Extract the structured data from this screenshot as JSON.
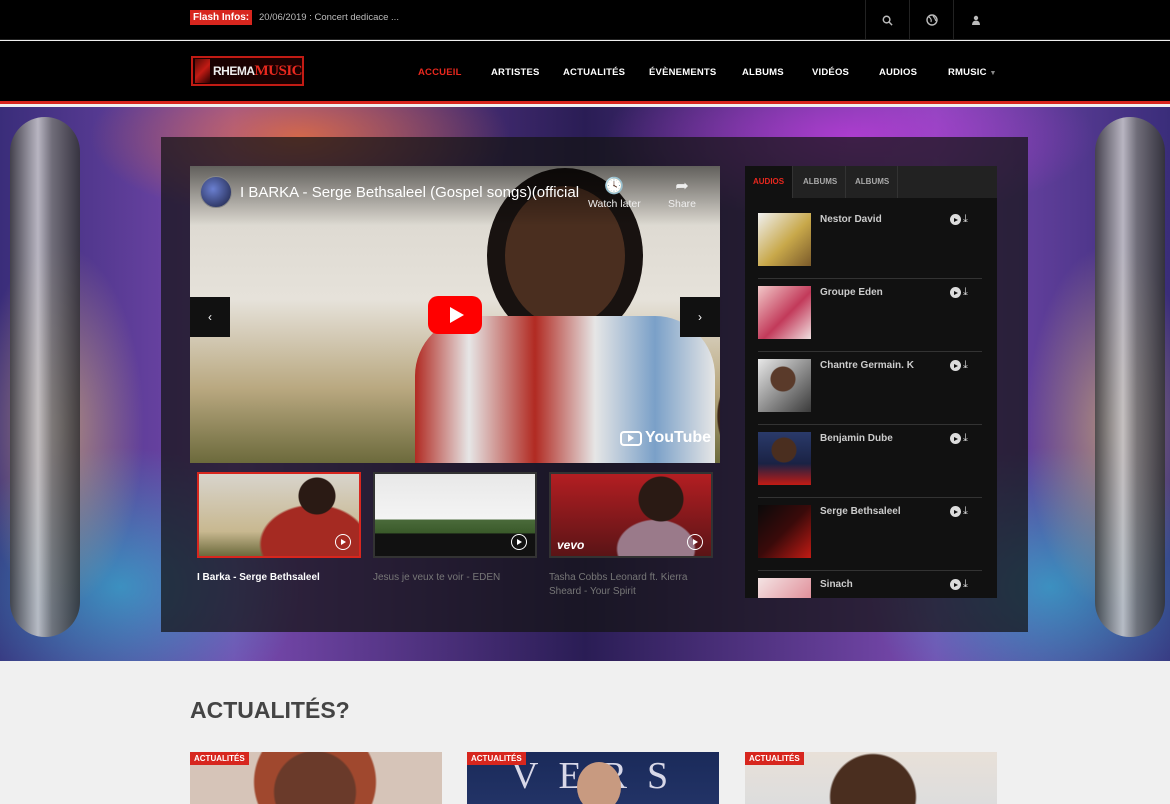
{
  "topbar": {
    "flash_label": "Flash Infos:",
    "flash_text": "20/06/2019 : Concert dedicace ..."
  },
  "logo": {
    "part1": "RHEMA",
    "part2": "MUSIC"
  },
  "nav": {
    "items": [
      "ACCUEIL",
      "ARTISTES",
      "ACTUALITÉS",
      "ÉVÈNEMENTS",
      "ALBUMS",
      "VIDÉOS",
      "AUDIOS",
      "RMUSIC"
    ],
    "active": "ACCUEIL"
  },
  "video": {
    "title": "I BARKA - Serge Bethsaleel (Gospel songs)(official ...",
    "watch_later": "Watch later",
    "share": "Share",
    "brand": "YouTube"
  },
  "thumbs": [
    {
      "caption": "I Barka - Serge Bethsaleel"
    },
    {
      "caption": "Jesus je veux te voir - EDEN"
    },
    {
      "caption": "Tasha Cobbs Leonard ft. Kierra Sheard - Your Spirit",
      "overlay": "vevo"
    }
  ],
  "audio_panel": {
    "tabs": [
      "AUDIOS",
      "ALBUMS",
      "ALBUMS"
    ],
    "active_tab": "AUDIOS",
    "tracks": [
      "Nestor David",
      "Groupe Eden",
      "Chantre Germain. K",
      "Benjamin Dube",
      "Serge Bethsaleel",
      "Sinach"
    ]
  },
  "section": {
    "title": "ACTUALITÉS?"
  },
  "cards": [
    {
      "badge": "ACTUALITÉS"
    },
    {
      "badge": "ACTUALITÉS",
      "image_text": "VERS"
    },
    {
      "badge": "ACTUALITÉS"
    }
  ],
  "colors": {
    "accent": "#d7261e",
    "dark": "#000000",
    "panel": "#111111"
  }
}
